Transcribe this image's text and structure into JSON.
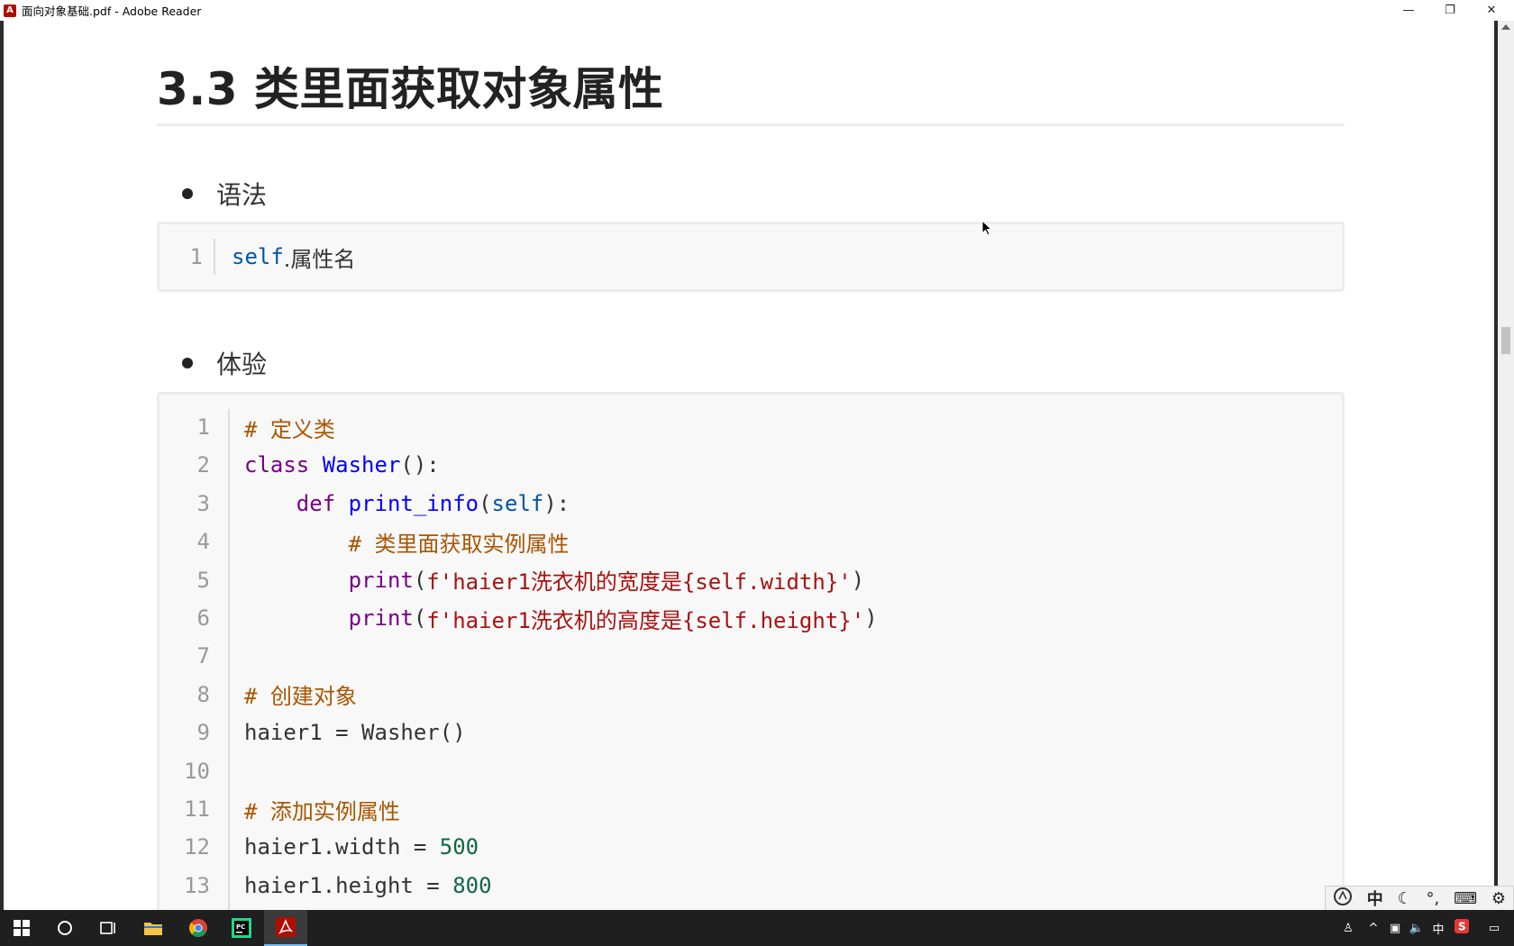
{
  "window": {
    "title": "面向对象基础.pdf - Adobe Reader",
    "app_icon": "adobe-reader-icon",
    "controls": {
      "minimize": "—",
      "restore": "❐",
      "close": "✕"
    }
  },
  "document": {
    "heading": "3.3 类里面获取对象属性",
    "bullet_syntax": "语法",
    "syntax_code": {
      "line_number": "1",
      "keyword": "self",
      "rest": ".属性名"
    },
    "bullet_example": "体验",
    "example_code": [
      {
        "n": "1",
        "tokens": [
          {
            "t": "# 定义类",
            "c": "cm"
          }
        ]
      },
      {
        "n": "2",
        "tokens": [
          {
            "t": "class ",
            "c": "kw"
          },
          {
            "t": "Washer",
            "c": "def"
          },
          {
            "t": "():",
            "c": ""
          }
        ]
      },
      {
        "n": "3",
        "tokens": [
          {
            "t": "    ",
            "c": ""
          },
          {
            "t": "def ",
            "c": "kw"
          },
          {
            "t": "print_info",
            "c": "def"
          },
          {
            "t": "(",
            "c": ""
          },
          {
            "t": "self",
            "c": "self"
          },
          {
            "t": "):",
            "c": ""
          }
        ]
      },
      {
        "n": "4",
        "tokens": [
          {
            "t": "        ",
            "c": ""
          },
          {
            "t": "# 类里面获取实例属性",
            "c": "cm"
          }
        ]
      },
      {
        "n": "5",
        "tokens": [
          {
            "t": "        ",
            "c": ""
          },
          {
            "t": "print",
            "c": "kw"
          },
          {
            "t": "(",
            "c": ""
          },
          {
            "t": "f'haier1洗衣机的宽度是{self.width}'",
            "c": "str"
          },
          {
            "t": ")",
            "c": ""
          }
        ]
      },
      {
        "n": "6",
        "tokens": [
          {
            "t": "        ",
            "c": ""
          },
          {
            "t": "print",
            "c": "kw"
          },
          {
            "t": "(",
            "c": ""
          },
          {
            "t": "f'haier1洗衣机的高度是{self.height}'",
            "c": "str"
          },
          {
            "t": ")",
            "c": ""
          }
        ]
      },
      {
        "n": "7",
        "tokens": []
      },
      {
        "n": "8",
        "tokens": [
          {
            "t": "# 创建对象",
            "c": "cm"
          }
        ]
      },
      {
        "n": "9",
        "tokens": [
          {
            "t": "haier1 = Washer()",
            "c": ""
          }
        ]
      },
      {
        "n": "10",
        "tokens": []
      },
      {
        "n": "11",
        "tokens": [
          {
            "t": "# 添加实例属性",
            "c": "cm"
          }
        ]
      },
      {
        "n": "12",
        "tokens": [
          {
            "t": "haier1.width = ",
            "c": ""
          },
          {
            "t": "500",
            "c": "num"
          }
        ]
      },
      {
        "n": "13",
        "tokens": [
          {
            "t": "haier1.height = ",
            "c": ""
          },
          {
            "t": "800",
            "c": "num"
          }
        ]
      }
    ]
  },
  "ime_bar": {
    "mode_label": "中",
    "icons": [
      "ime-logo-icon",
      "half-width-moon-icon",
      "punctuation-icon",
      "keyboard-icon",
      "settings-gear-icon"
    ]
  },
  "taskbar": {
    "items": [
      "windows-start-icon",
      "search-circle-icon",
      "task-view-icon",
      "file-explorer-icon",
      "chrome-icon",
      "pycharm-icon",
      "adobe-reader-icon"
    ],
    "tray": {
      "language": "中",
      "icons": [
        "people-icon",
        "chevron-up-icon",
        "network-icon",
        "volume-icon",
        "sogou-ime-icon",
        "notification-icon"
      ]
    }
  }
}
